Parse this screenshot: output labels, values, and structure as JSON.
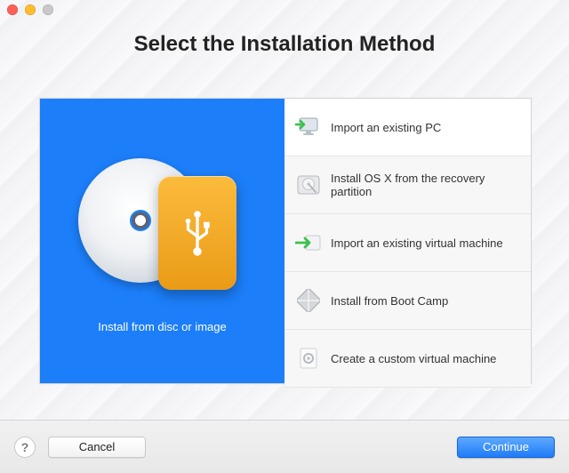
{
  "title": "Select the Installation Method",
  "preview": {
    "label": "Install from disc or image"
  },
  "options": [
    {
      "label": "Import an existing PC",
      "selected": true,
      "icon": "monitor-import"
    },
    {
      "label": "Install OS X from the recovery partition",
      "selected": false,
      "icon": "hdd"
    },
    {
      "label": "Import an existing virtual machine",
      "selected": false,
      "icon": "import-arrow"
    },
    {
      "label": "Install from Boot Camp",
      "selected": false,
      "icon": "bootcamp"
    },
    {
      "label": "Create a custom virtual machine",
      "selected": false,
      "icon": "gear-page"
    }
  ],
  "footer": {
    "help": "?",
    "cancel": "Cancel",
    "continue": "Continue"
  }
}
